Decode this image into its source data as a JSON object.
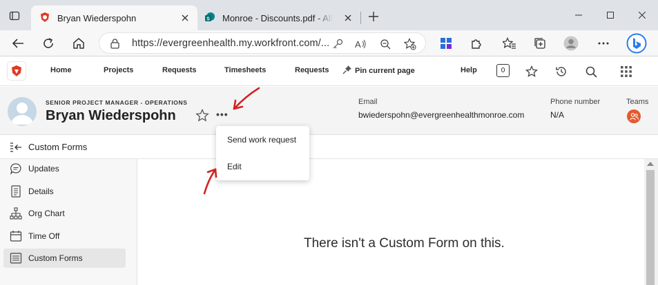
{
  "browser": {
    "tabs": [
      {
        "title": "Bryan Wiederspohn",
        "icon": "workfront-lion-icon",
        "active": true
      },
      {
        "title": "Monroe - Discounts.pdf - All Documents",
        "icon": "sharepoint-icon",
        "active": false
      }
    ],
    "address": {
      "url": "https://evergreenhealth.my.workfront.com/..."
    }
  },
  "nav": {
    "items": [
      "Home",
      "Projects",
      "Requests",
      "Timesheets",
      "Requests"
    ],
    "pin_label": "Pin current page",
    "help_label": "Help",
    "count_badge": "0"
  },
  "profile": {
    "role": "SENIOR PROJECT MANAGER - OPERATIONS",
    "name": "Bryan Wiederspohn",
    "more": "•••",
    "email_label": "Email",
    "email": "bwiederspohn@evergreenhealthmonroe.com",
    "phone_label": "Phone number",
    "phone": "N/A",
    "teams_label": "Teams"
  },
  "section": {
    "title": "Custom Forms"
  },
  "leftnav": {
    "items": [
      {
        "label": "Updates",
        "icon": "chat-bubble-icon"
      },
      {
        "label": "Details",
        "icon": "document-icon"
      },
      {
        "label": "Org Chart",
        "icon": "org-chart-icon"
      },
      {
        "label": "Time Off",
        "icon": "calendar-icon"
      },
      {
        "label": "Custom Forms",
        "icon": "form-icon",
        "selected": true
      }
    ]
  },
  "main": {
    "empty_message": "There isn't a Custom Form on this."
  },
  "menu": {
    "items": [
      "Send work request",
      "Edit"
    ]
  },
  "colors": {
    "annotation_red": "#d32121",
    "teams_badge": "#e35a2f",
    "tab_strip": "#dfe3e8"
  }
}
